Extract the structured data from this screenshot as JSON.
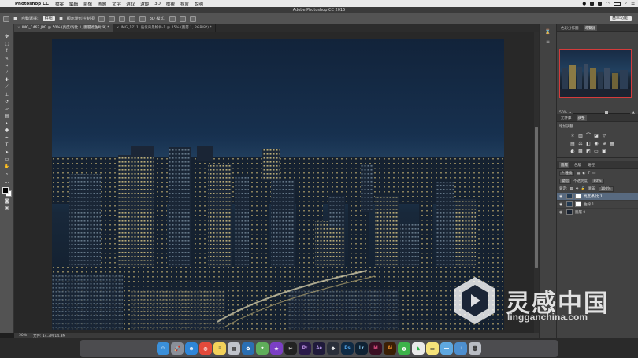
{
  "menubar": {
    "app_name": "Photoshop CC",
    "items": [
      "檔案",
      "編輯",
      "影像",
      "圖層",
      "文字",
      "選取",
      "濾鏡",
      "3D",
      "檢視",
      "視窗",
      "說明"
    ]
  },
  "window": {
    "title": "Adobe Photoshop CC 2015"
  },
  "options": {
    "auto_select_label": "自動選擇:",
    "auto_select_value": "群組",
    "transform_label": "顯示變形控制項",
    "mode_3d_label": "3D 模式:",
    "workspace_value": "基本功能"
  },
  "tabs": [
    {
      "label": "IMG_1462.JPG @ 50% (亮度/對比 1, 圖層遮色片/8) *",
      "active": true
    },
    {
      "label": "IMG_1711, 強化背景物件-1 @ 25% (圖層 1, RGB/8*) *",
      "active": false
    }
  ],
  "tools": [
    "move",
    "marquee",
    "lasso",
    "quick-select",
    "crop",
    "eyedropper",
    "healing",
    "brush",
    "stamp",
    "history-brush",
    "eraser",
    "gradient",
    "blur",
    "dodge",
    "pen",
    "type",
    "path-select",
    "shape",
    "hand",
    "zoom",
    "more"
  ],
  "status": {
    "zoom": "50%",
    "doc": "文件: 14.3M/14.3M"
  },
  "panels": {
    "navigator_tabs": [
      "色彩分佈圖",
      "導覽器"
    ],
    "navigator_zoom": "50%",
    "adjust_tabs": [
      "元件庫",
      "調整"
    ],
    "adjust_label": "增加調整",
    "layer_tabs": [
      "圖層",
      "色版",
      "路徑"
    ],
    "layer_filter": "P 種類",
    "blend_mode": "變暗",
    "opacity_label": "不透明度:",
    "opacity_value": "80%",
    "lock_label": "鎖定:",
    "fill_label": "填滿:",
    "fill_value": "100%",
    "layers": [
      {
        "name": "亮度/對比 1",
        "selected": true
      },
      {
        "name": "曲線 1",
        "selected": false
      },
      {
        "name": "圖層 0",
        "selected": false
      }
    ]
  },
  "dock": [
    "Finder",
    "Launchpad",
    "Safari",
    "Chrome",
    "Notes",
    "Preview",
    "Photos",
    "Maps",
    "Motion",
    "FinalCut",
    "Pr",
    "Ae",
    "DaVinci",
    "Ps",
    "Lr",
    "Id",
    "Ai",
    "WeChat",
    "Evernote",
    "Note2",
    "Folder",
    "Downloads",
    "Trash"
  ],
  "watermark": {
    "cn": "灵感中国",
    "en": "lingganchina.com"
  }
}
